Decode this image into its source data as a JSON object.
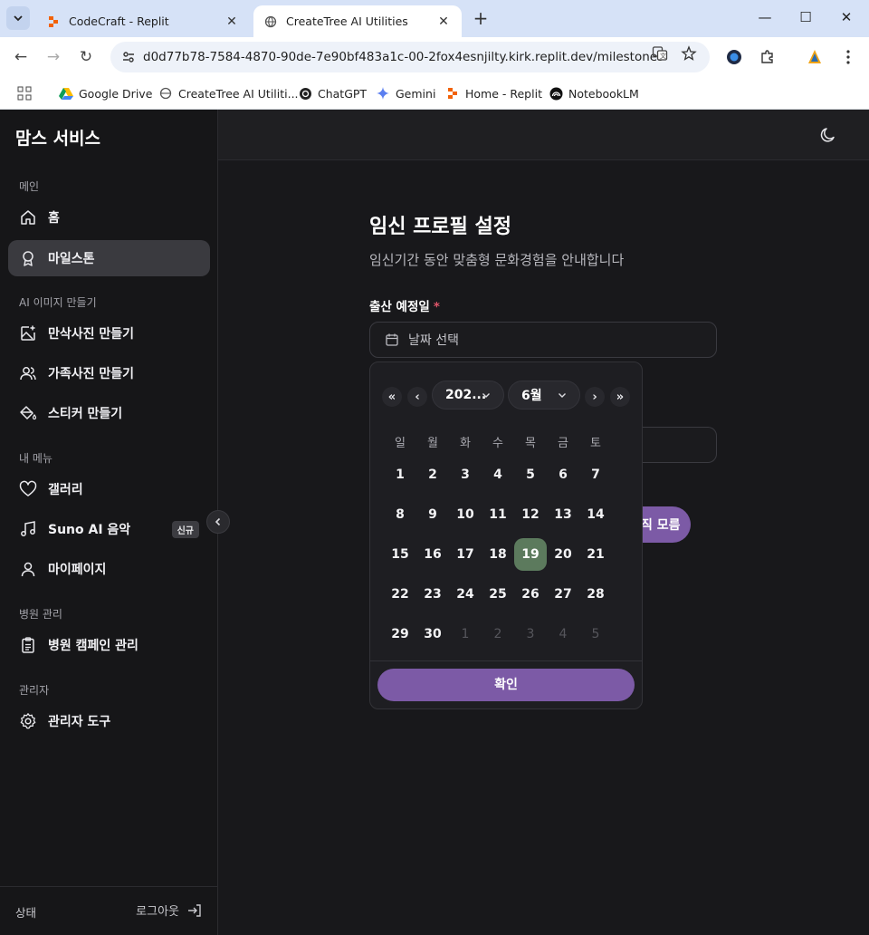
{
  "browser": {
    "tabs": [
      {
        "title": "CodeCraft - Replit",
        "active": false
      },
      {
        "title": "CreateTree AI Utilities",
        "active": true
      }
    ],
    "url": "d0d77b78-7584-4870-90de-7e90bf483a1c-00-2fox4esnjilty.kirk.replit.dev/milestones",
    "bookmarks": [
      {
        "label": "Google Drive"
      },
      {
        "label": "CreateTree AI Utiliti..."
      },
      {
        "label": "ChatGPT"
      },
      {
        "label": "Gemini"
      },
      {
        "label": "Home - Replit"
      },
      {
        "label": "NotebookLM"
      }
    ]
  },
  "sidebar": {
    "brand": "맘스 서비스",
    "sections": {
      "main": "메인",
      "ai": "AI 이미지 만들기",
      "mymenu": "내 메뉴",
      "hospital": "병원 관리",
      "admin": "관리자"
    },
    "items": {
      "home": "홈",
      "milestones": "마일스톤",
      "maternity_photo": "만삭사진 만들기",
      "family_photo": "가족사진 만들기",
      "sticker": "스티커 만들기",
      "gallery": "갤러리",
      "suno": "Suno AI 음악",
      "suno_badge": "신규",
      "mypage": "마이페이지",
      "campaign": "병원 캠페인 관리",
      "admin_tools": "관리자 도구"
    },
    "footer": {
      "status": "상태",
      "logout": "로그아웃"
    }
  },
  "main": {
    "title": "임신 프로필 설정",
    "subtitle": "임신기간 동안 맞춤형 문화경험을 안내합니다",
    "due_date_label": "출산 예정일",
    "required_mark": "*",
    "date_placeholder": "날짜 선택",
    "submit_partial": "직 모름"
  },
  "calendar": {
    "year_value": "202...",
    "month_value": "6월",
    "weekdays": [
      "일",
      "월",
      "화",
      "수",
      "목",
      "금",
      "토"
    ],
    "weeks": [
      [
        "1",
        "2",
        "3",
        "4",
        "5",
        "6",
        "7"
      ],
      [
        "8",
        "9",
        "10",
        "11",
        "12",
        "13",
        "14"
      ],
      [
        "15",
        "16",
        "17",
        "18",
        "19",
        "20",
        "21"
      ],
      [
        "22",
        "23",
        "24",
        "25",
        "26",
        "27",
        "28"
      ],
      [
        "29",
        "30",
        "1",
        "2",
        "3",
        "4",
        "5"
      ]
    ],
    "selected_day": "19",
    "confirm": "확인"
  },
  "colors": {
    "accent": "#7c5aa6",
    "selected_day": "#5c7a5d",
    "required": "#e0556a"
  }
}
